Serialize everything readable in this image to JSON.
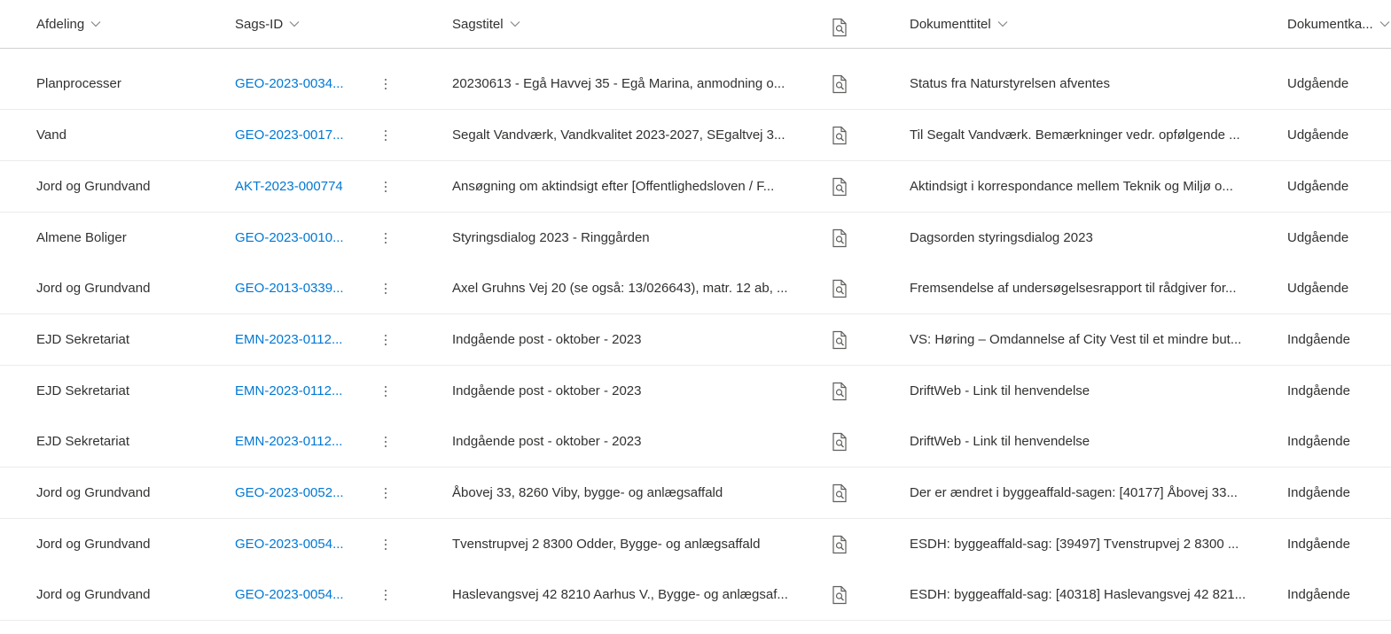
{
  "columns": {
    "afdeling": "Afdeling",
    "sags_id": "Sags-ID",
    "sagstitel": "Sagstitel",
    "preview": "preview-icon",
    "dokumenttitel": "Dokumenttitel",
    "dokumentkategori": "Dokumentka..."
  },
  "rows": [
    {
      "afdeling": "Planprocesser",
      "sags_id": "GEO-2023-0034...",
      "sagstitel": "20230613 - Egå Havvej 35 - Egå Marina, anmodning o...",
      "dokumenttitel": "Status fra Naturstyrelsen afventes",
      "kategori": "Udgående"
    },
    {
      "afdeling": "Vand",
      "sags_id": "GEO-2023-0017...",
      "sagstitel": "Segalt Vandværk, Vandkvalitet 2023-2027, SEgaltvej 3...",
      "dokumenttitel": "Til Segalt Vandværk. Bemærkninger vedr. opfølgende ...",
      "kategori": "Udgående"
    },
    {
      "afdeling": "Jord og Grundvand",
      "sags_id": "AKT-2023-000774",
      "sagstitel": "Ansøgning om aktindsigt efter [Offentlighedsloven / F...",
      "dokumenttitel": "Aktindsigt i korrespondance mellem Teknik og Miljø o...",
      "kategori": "Udgående"
    },
    {
      "afdeling": "Almene Boliger",
      "sags_id": "GEO-2023-0010...",
      "sagstitel": "Styringsdialog 2023 - Ringgården",
      "dokumenttitel": "Dagsorden styringsdialog 2023",
      "kategori": "Udgående"
    },
    {
      "afdeling": "Jord og Grundvand",
      "sags_id": "GEO-2013-0339...",
      "sagstitel": "Axel Gruhns Vej 20 (se også: 13/026643), matr. 12 ab, ...",
      "dokumenttitel": "Fremsendelse af undersøgelsesrapport til rådgiver for...",
      "kategori": "Udgående"
    },
    {
      "afdeling": "EJD Sekretariat",
      "sags_id": "EMN-2023-0112...",
      "sagstitel": "Indgående post - oktober - 2023",
      "dokumenttitel": "VS: Høring – Omdannelse af City Vest til et mindre but...",
      "kategori": "Indgående"
    },
    {
      "afdeling": "EJD Sekretariat",
      "sags_id": "EMN-2023-0112...",
      "sagstitel": "Indgående post - oktober - 2023",
      "dokumenttitel": "DriftWeb - Link til henvendelse",
      "kategori": "Indgående"
    },
    {
      "afdeling": "EJD Sekretariat",
      "sags_id": "EMN-2023-0112...",
      "sagstitel": "Indgående post - oktober - 2023",
      "dokumenttitel": "DriftWeb - Link til henvendelse",
      "kategori": "Indgående"
    },
    {
      "afdeling": "Jord og Grundvand",
      "sags_id": "GEO-2023-0052...",
      "sagstitel": "Åbovej 33, 8260 Viby, bygge- og anlægsaffald",
      "dokumenttitel": "Der er ændret i byggeaffald-sagen: [40177] Åbovej 33...",
      "kategori": "Indgående"
    },
    {
      "afdeling": "Jord og Grundvand",
      "sags_id": "GEO-2023-0054...",
      "sagstitel": "Tvenstrupvej 2 8300 Odder, Bygge- og anlægsaffald",
      "dokumenttitel": "ESDH: byggeaffald-sag: [39497] Tvenstrupvej 2 8300 ...",
      "kategori": "Indgående"
    },
    {
      "afdeling": "Jord og Grundvand",
      "sags_id": "GEO-2023-0054...",
      "sagstitel": "Haslevangsvej 42 8210 Aarhus V., Bygge- og anlægsaf...",
      "dokumenttitel": "ESDH: byggeaffald-sag: [40318] Haslevangsvej 42 821...",
      "kategori": "Indgående"
    }
  ],
  "colors": {
    "link": "#0078d4",
    "text": "#323130",
    "border": "#edebe9"
  }
}
